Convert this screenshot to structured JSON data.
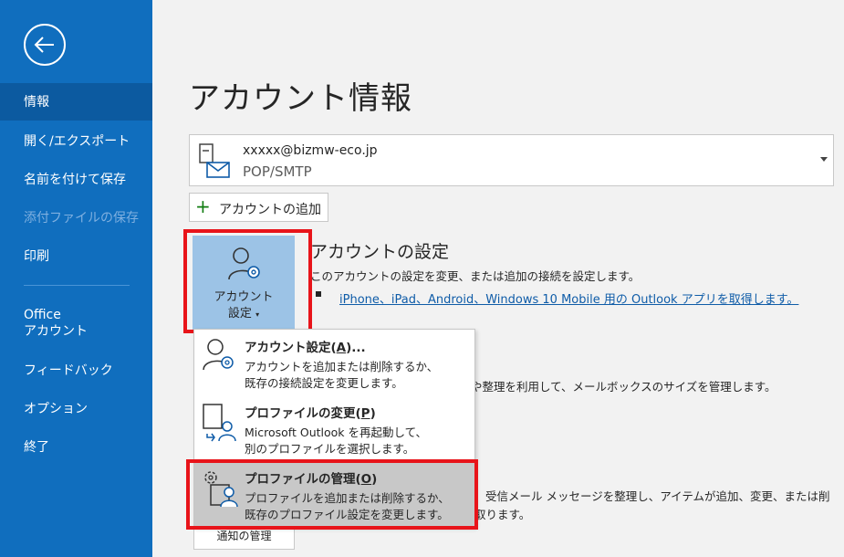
{
  "sidebar": {
    "items": [
      {
        "label": "情報",
        "state": "active"
      },
      {
        "label": "開く/エクスポート",
        "state": "normal"
      },
      {
        "label": "名前を付けて保存",
        "state": "normal"
      },
      {
        "label": "添付ファイルの保存",
        "state": "disabled"
      },
      {
        "label": "印刷",
        "state": "normal"
      },
      {
        "label": "Office",
        "label2": "アカウント",
        "state": "normal"
      },
      {
        "label": "フィードバック",
        "state": "normal"
      },
      {
        "label": "オプション",
        "state": "normal"
      },
      {
        "label": "終了",
        "state": "normal"
      }
    ]
  },
  "main": {
    "title": "アカウント情報",
    "account": {
      "email": "xxxxx@bizmw-eco.jp",
      "type": "POP/SMTP"
    },
    "add_account_label": "アカウントの追加",
    "settings_button": {
      "line1": "アカウント",
      "line2": "設定"
    },
    "section": {
      "title": "アカウントの設定",
      "description": "このアカウントの設定を変更、または追加の接続を設定します。",
      "link": "iPhone、iPad、Android、Windows 10 Mobile 用の Outlook アプリを取得します。"
    },
    "bg_text_1": "や整理を利用して、メールボックスのサイズを管理します。",
    "bg_text_2": "受信メール メッセージを整理し、アイテムが追加、変更、または削",
    "bg_text_3": "取ります。",
    "ghost_button": "通知の管理"
  },
  "menu": {
    "items": [
      {
        "title": "アカウント設定(",
        "key": "A",
        "title_end": ")...",
        "desc1": "アカウントを追加または削除するか、",
        "desc2": "既存の接続設定を変更します。",
        "icon": "account-settings-icon"
      },
      {
        "title": "プロファイルの変更(",
        "key": "P",
        "title_end": ")",
        "desc1": "Microsoft Outlook を再起動して、",
        "desc2": "別のプロファイルを選択します。",
        "icon": "change-profile-icon"
      },
      {
        "title": "プロファイルの管理(",
        "key": "O",
        "title_end": ")",
        "desc1": "プロファイルを追加または削除するか、",
        "desc2": "既存のプロファイル設定を変更します。",
        "icon": "manage-profiles-icon"
      }
    ]
  },
  "colors": {
    "sidebar": "#106ebe",
    "highlight": "#e8141a",
    "link": "#0f5ca8",
    "button_active": "#9cc3e6"
  }
}
